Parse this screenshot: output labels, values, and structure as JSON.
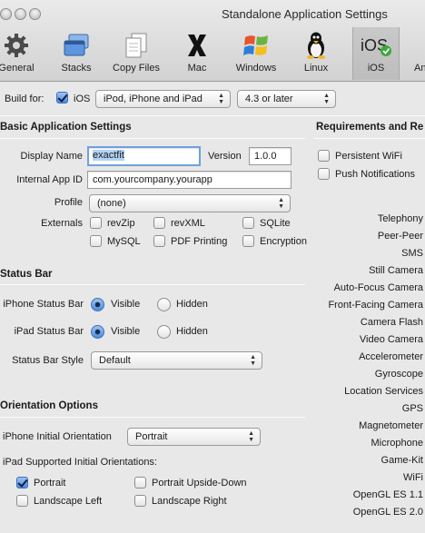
{
  "window": {
    "title": "Standalone Application Settings"
  },
  "toolbar": {
    "items": [
      {
        "label": "General",
        "icon": "gear-icon"
      },
      {
        "label": "Stacks",
        "icon": "stacks-icon"
      },
      {
        "label": "Copy Files",
        "icon": "copy-files-icon"
      },
      {
        "label": "Mac",
        "icon": "mac-icon"
      },
      {
        "label": "Windows",
        "icon": "windows-icon"
      },
      {
        "label": "Linux",
        "icon": "linux-icon"
      },
      {
        "label": "iOS",
        "icon": "ios-icon"
      },
      {
        "label": "An",
        "icon": "android-icon"
      }
    ],
    "selected": "iOS"
  },
  "build": {
    "label": "Build for:",
    "ios_checkbox_label": "iOS",
    "ios_checked": true,
    "device_select": "iPod, iPhone and iPad",
    "version_select": "4.3 or later"
  },
  "basic": {
    "title": "Basic Application Settings",
    "display_name_label": "Display Name",
    "display_name_value": "exactfit",
    "version_label": "Version",
    "version_value": "1.0.0",
    "app_id_label": "Internal App ID",
    "app_id_value": "com.yourcompany.yourapp",
    "profile_label": "Profile",
    "profile_value": "(none)",
    "externals_label": "Externals",
    "externals": [
      "revZip",
      "revXML",
      "SQLite",
      "MySQL",
      "PDF Printing",
      "Encryption"
    ]
  },
  "status_bar": {
    "title": "Status Bar",
    "iphone_label": "iPhone Status Bar",
    "ipad_label": "iPad Status Bar",
    "visible_label": "Visible",
    "hidden_label": "Hidden",
    "iphone_value": "Visible",
    "ipad_value": "Visible",
    "style_label": "Status Bar Style",
    "style_value": "Default"
  },
  "orientation": {
    "title": "Orientation Options",
    "iphone_initial_label": "iPhone Initial Orientation",
    "iphone_initial_value": "Portrait",
    "ipad_supported_label": "iPad Supported Initial Orientations:",
    "options": [
      {
        "label": "Portrait",
        "checked": true
      },
      {
        "label": "Portrait Upside-Down",
        "checked": false
      },
      {
        "label": "Landscape Left",
        "checked": false
      },
      {
        "label": "Landscape Right",
        "checked": false
      }
    ]
  },
  "requirements": {
    "title": "Requirements and Re",
    "persistent_wifi": "Persistent WiFi",
    "push_notifications": "Push Notifications",
    "capabilities": [
      "Telephony",
      "Peer-Peer",
      "SMS",
      "Still Camera",
      "Auto-Focus Camera",
      "Front-Facing Camera",
      "Camera Flash",
      "Video Camera",
      "Accelerometer",
      "Gyroscope",
      "Location Services",
      "GPS",
      "Magnetometer",
      "Microphone",
      "Game-Kit",
      "WiFi",
      "OpenGL ES 1.1",
      "OpenGL ES 2.0"
    ]
  }
}
